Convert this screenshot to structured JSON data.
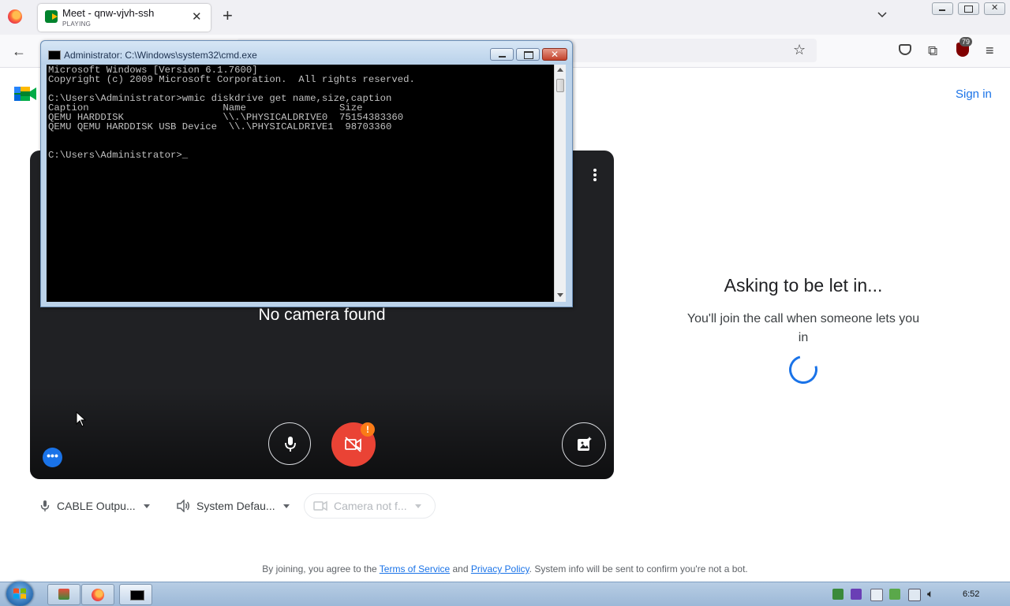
{
  "browser": {
    "tab": {
      "title": "Meet - qnw-vjvh-ssh",
      "status": "PLAYING"
    },
    "extension_badge": "79"
  },
  "meet": {
    "sign_in": "Sign in",
    "preview": {
      "no_camera": "No camera found"
    },
    "devices": {
      "microphone": "CABLE Outpu...",
      "speaker": "System Defau...",
      "camera": "Camera not f..."
    },
    "status": {
      "heading": "Asking to be let in...",
      "note": "You'll join the call when someone lets you in"
    },
    "footer": {
      "prefix": "By joining, you agree to the ",
      "terms": "Terms of Service",
      "and": " and ",
      "privacy": "Privacy Policy",
      "suffix": ". System info will be sent to confirm you're not a bot."
    },
    "accent_color": "#1a73e8",
    "camera_off_color": "#ea4335"
  },
  "cmd": {
    "title": "Administrator: C:\\Windows\\system32\\cmd.exe",
    "output": "Microsoft Windows [Version 6.1.7600]\nCopyright (c) 2009 Microsoft Corporation.  All rights reserved.\n\nC:\\Users\\Administrator>wmic diskdrive get name,size,caption\nCaption                       Name                Size\nQEMU HARDDISK                 \\\\.\\PHYSICALDRIVE0  75154383360\nQEMU QEMU HARDDISK USB Device  \\\\.\\PHYSICALDRIVE1  98703360\n\n\nC:\\Users\\Administrator>_"
  },
  "taskbar": {
    "clock": "6:52",
    "items": [
      "app-icon",
      "firefox-icon",
      "cmd-icon"
    ]
  }
}
